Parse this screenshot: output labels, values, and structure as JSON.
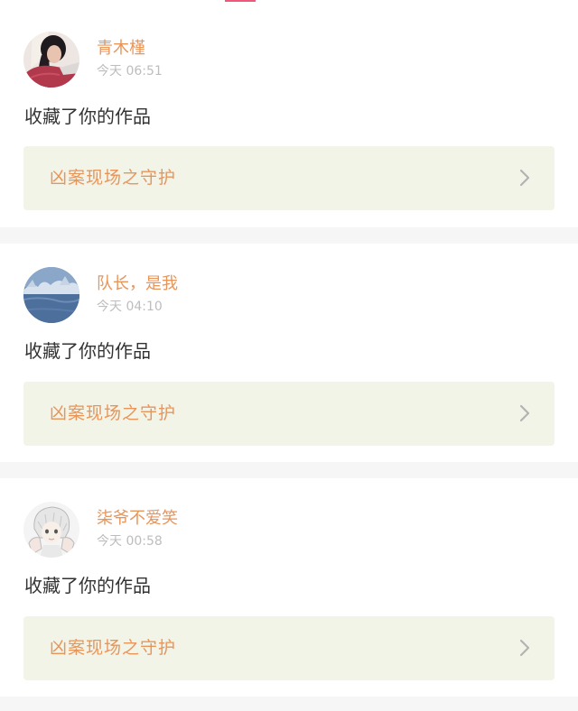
{
  "feed": [
    {
      "username": "青木槿",
      "time": "今天 06:51",
      "action": "收藏了你的作品",
      "work_title": "凶案现场之守护",
      "avatar_icon": "avatar-girl-red-sweater"
    },
    {
      "username": "队长，是我",
      "time": "今天 04:10",
      "action": "收藏了你的作品",
      "work_title": "凶案现场之守护",
      "avatar_icon": "avatar-snowy-landscape"
    },
    {
      "username": "柒爷不爱笑",
      "time": "今天 00:58",
      "action": "收藏了你的作品",
      "work_title": "凶案现场之守护",
      "avatar_icon": "avatar-anime-white-hair"
    }
  ],
  "colors": {
    "accent": "#e8955a",
    "tab_indicator": "#f0587a",
    "work_box_bg": "#f2f4e8",
    "page_bg": "#f6f6f6"
  }
}
